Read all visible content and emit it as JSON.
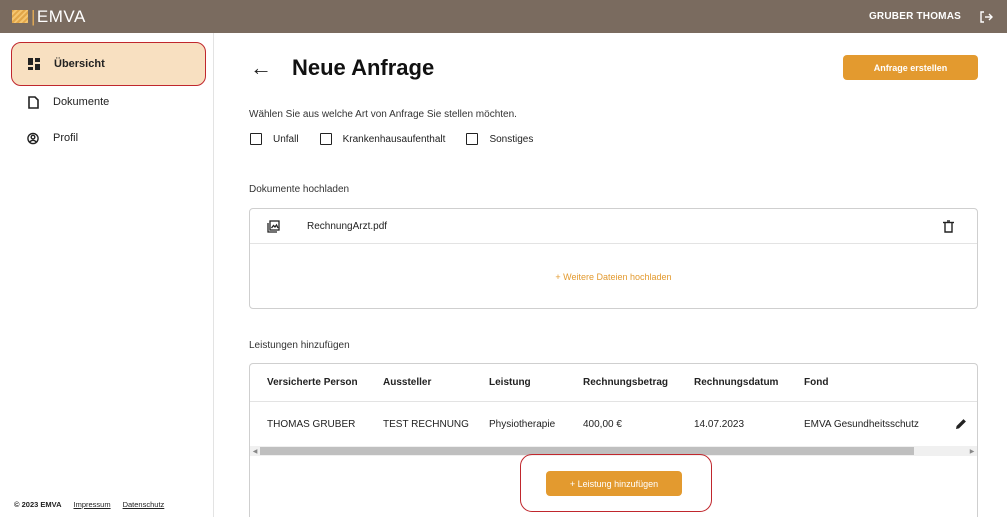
{
  "app": {
    "logo_text": "EMVA",
    "user_name": "GRUBER THOMAS"
  },
  "sidebar": {
    "items": [
      {
        "label": "Übersicht",
        "active": true,
        "icon": "dashboard-icon"
      },
      {
        "label": "Dokumente",
        "active": false,
        "icon": "document-icon"
      },
      {
        "label": "Profil",
        "active": false,
        "icon": "profile-icon"
      }
    ],
    "footer": {
      "copyright": "© 2023 EMVA",
      "impressum": "Impressum",
      "datenschutz": "Datenschutz"
    }
  },
  "page": {
    "title": "Neue Anfrage",
    "primary_action": "Anfrage erstellen",
    "intro": "Wählen Sie aus welche Art von Anfrage Sie stellen möchten.",
    "request_types": [
      "Unfall",
      "Krankenhausaufenthalt",
      "Sonstiges"
    ]
  },
  "documents": {
    "section_label": "Dokumente hochladen",
    "files": [
      {
        "name": "RechnungArzt.pdf"
      }
    ],
    "more_upload": "+  Weitere Dateien hochladen"
  },
  "services": {
    "section_label": "Leistungen hinzufügen",
    "columns": [
      "Versicherte Person",
      "Aussteller",
      "Leistung",
      "Rechnungsbetrag",
      "Rechnungsdatum",
      "Fond"
    ],
    "rows": [
      [
        "THOMAS GRUBER",
        "TEST RECHNUNG",
        "Physiotherapie",
        "400,00 €",
        "14.07.2023",
        "EMVA Gesundheitsschutz"
      ]
    ],
    "add_label": "+  Leistung hinzufügen"
  },
  "colors": {
    "topbar": "#7a6b5f",
    "accent": "#e39a2f",
    "active_nav": "#f8e0c1",
    "highlight_outline": "#c0272d"
  }
}
